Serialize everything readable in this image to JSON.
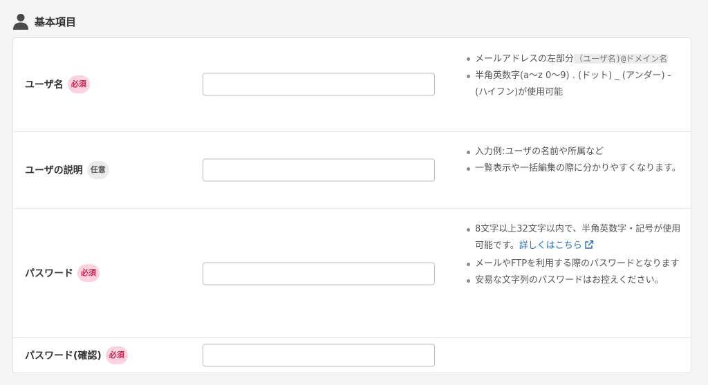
{
  "section": {
    "title": "基本項目",
    "icon": "user-icon"
  },
  "colors": {
    "required_bg": "#fcd3df",
    "required_text": "#c82954",
    "optional_bg": "#ebebeb",
    "link": "#1f6fb2"
  },
  "fields": {
    "username": {
      "label": "ユーザ名",
      "badge": "必須",
      "value": "",
      "notes": {
        "n1_text": "メールアドレスの左部分",
        "n1_highlight": "（ユーザ名)@ドメイン名",
        "n2": "半角英数字(a〜z 0〜9) . (ドット) _ (アンダー) - (ハイフン)が使用可能"
      }
    },
    "description": {
      "label": "ユーザの説明",
      "badge": "任意",
      "value": "",
      "notes": {
        "n1": "入力例:ユーザの名前や所属など",
        "n2": "一覧表示や一括編集の際に分かりやすくなります。"
      }
    },
    "password": {
      "label": "パスワード",
      "badge": "必須",
      "value": "",
      "notes": {
        "n1_text": "8文字以上32文字以内で、半角英数字・記号が使用可能です。",
        "n1_link": "詳しくはこちら",
        "n2": "メールやFTPを利用する際のパスワードとなります",
        "n3": "安易な文字列のパスワードはお控えください。"
      }
    },
    "password_confirm": {
      "label": "パスワード(確認)",
      "badge": "必須",
      "value": ""
    }
  }
}
